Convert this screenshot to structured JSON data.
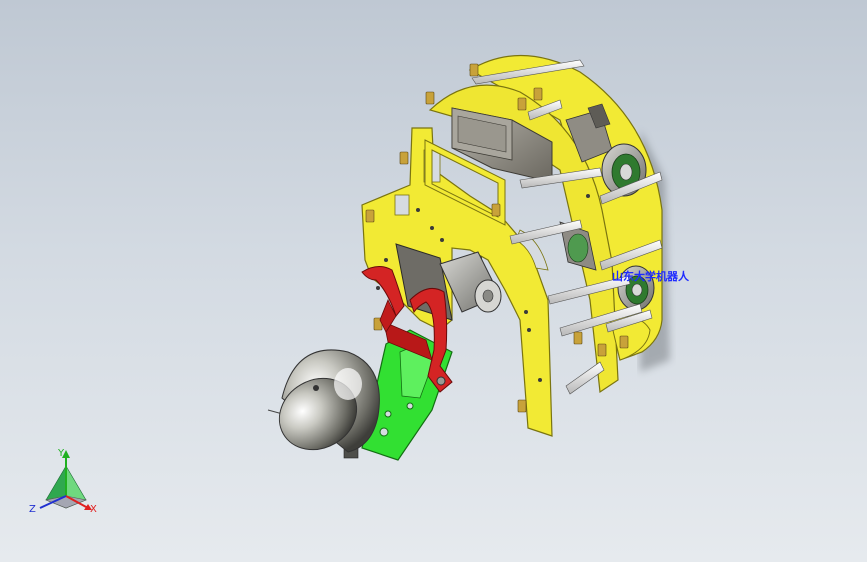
{
  "annotation": {
    "text": "山东大学机器人"
  },
  "triad": {
    "x_label": "X",
    "y_label": "Y",
    "z_label": "Z"
  },
  "colors": {
    "plate": "#f2ea34",
    "plate_edge": "#7a7410",
    "gripper": "#d42424",
    "arm": "#32e032",
    "annotation": "#1e2bff",
    "axis_x": "#e02020",
    "axis_y": "#20b020",
    "axis_z": "#2030d0"
  }
}
